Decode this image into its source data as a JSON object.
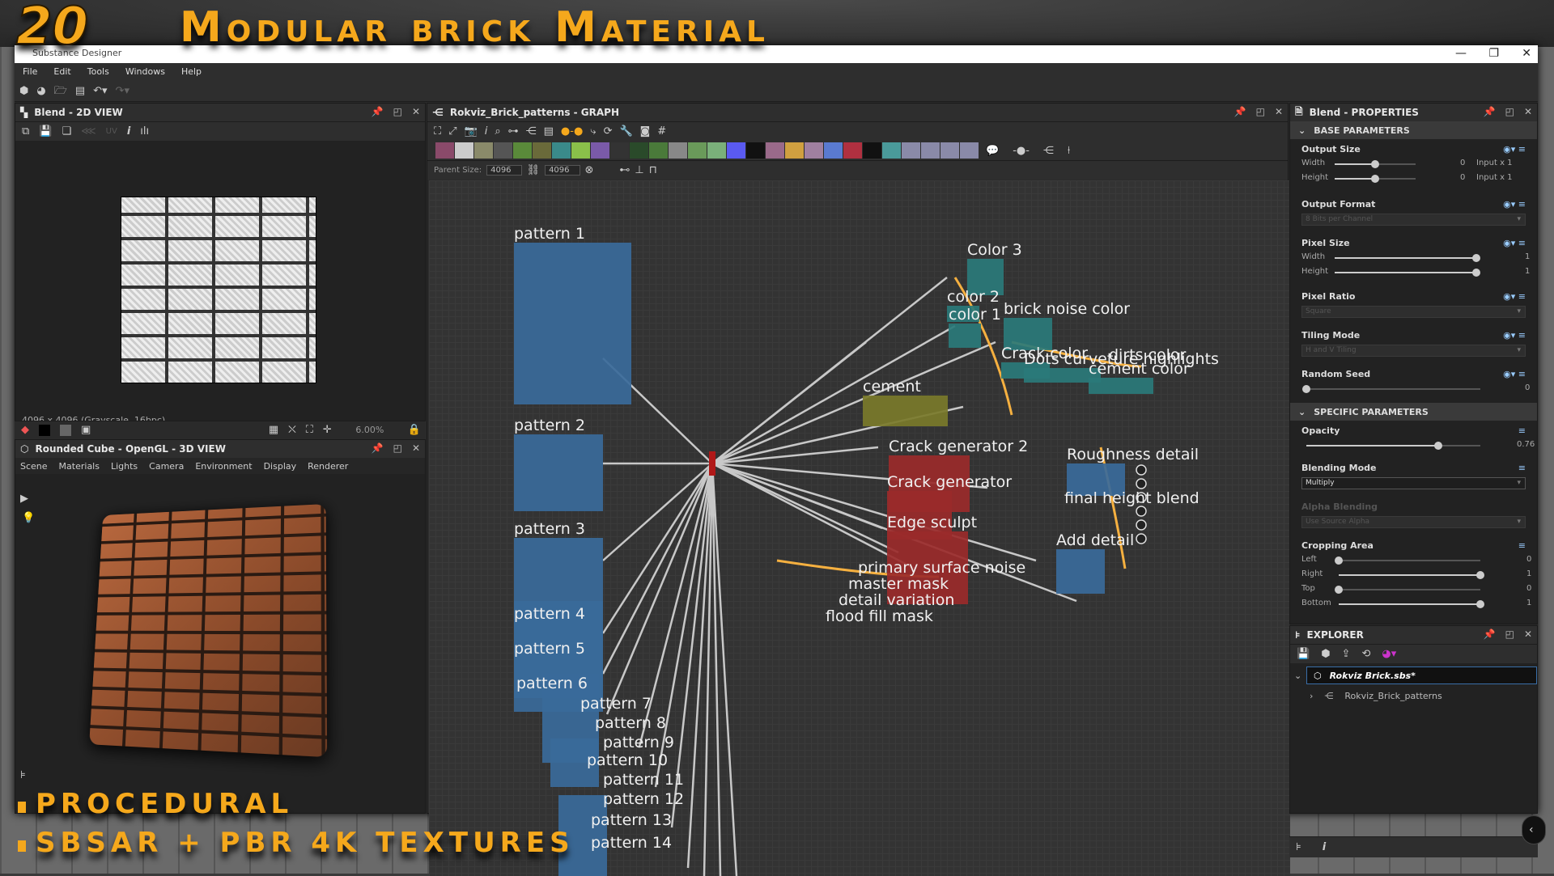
{
  "overlay": {
    "number": "20",
    "title": "Modular brick Material",
    "bullets": [
      "PROCEDURAL",
      "SBSAR + PBR 4K TEXTURES"
    ],
    "accent": "#f5a81c"
  },
  "window": {
    "app_title": "Substance Designer",
    "controls": [
      "minimize",
      "restore",
      "close"
    ]
  },
  "menu": [
    "File",
    "Edit",
    "Tools",
    "Windows",
    "Help"
  ],
  "main_toolbar": [
    "new-substance-icon",
    "new-graph-icon",
    "open-icon",
    "save-all-icon",
    "undo-icon",
    "redo-icon"
  ],
  "view2d": {
    "title": "Blend - 2D VIEW",
    "toolbar": [
      "display-icon",
      "save-icon",
      "copy-icon",
      "share-icon",
      "UV",
      "info-icon",
      "histogram-icon"
    ],
    "uv_label": "UV",
    "status": "4096 x 4096 (Grayscale, 16bpc)",
    "zoom": "6.00%"
  },
  "view3d": {
    "title": "Rounded Cube - OpenGL - 3D VIEW",
    "menu": [
      "Scene",
      "Materials",
      "Lights",
      "Camera",
      "Environment",
      "Display",
      "Renderer"
    ]
  },
  "graph": {
    "title": "Rokviz_Brick_patterns - GRAPH",
    "parent_size_label": "Parent Size:",
    "size_w": "4096",
    "size_h": "4096",
    "frames": [
      {
        "label": "pattern 1"
      },
      {
        "label": "pattern 2"
      },
      {
        "label": "pattern 3"
      },
      {
        "label": "pattern 4"
      },
      {
        "label": "pattern 5"
      },
      {
        "label": "pattern 6"
      },
      {
        "label": "pattern 7"
      },
      {
        "label": "pattern 8"
      },
      {
        "label": "pattern 9"
      },
      {
        "label": "pattern 10"
      },
      {
        "label": "pattern 11"
      },
      {
        "label": "pattern 12"
      },
      {
        "label": "pattern 13"
      },
      {
        "label": "pattern 14"
      },
      {
        "label": "Color 3"
      },
      {
        "label": "color 2"
      },
      {
        "label": "color 1"
      },
      {
        "label": "brick noise color"
      },
      {
        "label": "Crack color"
      },
      {
        "label": "Dots curveture highlights"
      },
      {
        "label": "dirts color"
      },
      {
        "label": "cement color"
      },
      {
        "label": "cement"
      },
      {
        "label": "Crack generator 2"
      },
      {
        "label": "Crack generator"
      },
      {
        "label": "Edge sculpt"
      },
      {
        "label": "Roughness detail"
      },
      {
        "label": "final height blend"
      },
      {
        "label": "Add detail"
      },
      {
        "label": "primary surface noise"
      },
      {
        "label": "master mask"
      },
      {
        "label": "detail variation"
      },
      {
        "label": "flood fill mask"
      }
    ]
  },
  "properties": {
    "title": "Blend - PROPERTIES",
    "base_section": "BASE PARAMETERS",
    "specific_section": "SPECIFIC PARAMETERS",
    "output_size": {
      "label": "Output Size",
      "width_label": "Width",
      "height_label": "Height",
      "width_value": "0",
      "height_value": "0",
      "width_mode": "Input x 1",
      "height_mode": "Input x 1",
      "width_pos": 0.5,
      "height_pos": 0.5
    },
    "output_format": {
      "label": "Output Format",
      "value": "8 Bits per Channel"
    },
    "pixel_size": {
      "label": "Pixel Size",
      "width_label": "Width",
      "height_label": "Height",
      "width_value": "1",
      "height_value": "1",
      "width_pos": 1.0,
      "height_pos": 1.0
    },
    "pixel_ratio": {
      "label": "Pixel Ratio",
      "value": "Square"
    },
    "tiling_mode": {
      "label": "Tiling Mode",
      "value": "H and V Tiling"
    },
    "random_seed": {
      "label": "Random Seed",
      "value": "0",
      "pos": 0.0
    },
    "opacity": {
      "label": "Opacity",
      "value": "0.76",
      "pos": 0.76
    },
    "blending_mode": {
      "label": "Blending Mode",
      "value": "Multiply"
    },
    "alpha_blending": {
      "label": "Alpha Blending",
      "value": "Use Source Alpha"
    },
    "cropping": {
      "label": "Cropping Area",
      "rows": [
        {
          "label": "Left",
          "value": "0",
          "pos": 0
        },
        {
          "label": "Right",
          "value": "1",
          "pos": 1
        },
        {
          "label": "Top",
          "value": "0",
          "pos": 0
        },
        {
          "label": "Bottom",
          "value": "1",
          "pos": 1
        }
      ]
    }
  },
  "explorer": {
    "title": "EXPLORER",
    "package": "Rokviz Brick.sbs*",
    "graph_item": "Rokviz_Brick_patterns"
  }
}
